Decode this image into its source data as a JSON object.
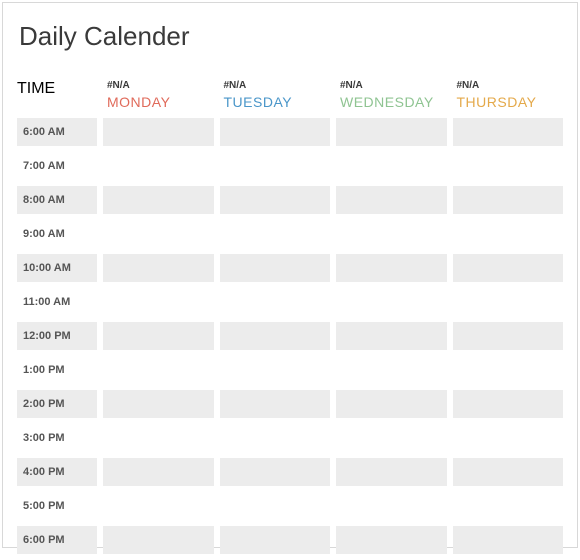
{
  "title": "Daily Calender",
  "time_label": "TIME",
  "na_label": "#N/A",
  "days": [
    {
      "name": "MONDAY",
      "color": "#e06a5a"
    },
    {
      "name": "TUESDAY",
      "color": "#4a96c9"
    },
    {
      "name": "WEDNESDAY",
      "color": "#8fc492"
    },
    {
      "name": "THURSDAY",
      "color": "#e4a94a"
    }
  ],
  "times": [
    "6:00 AM",
    "7:00 AM",
    "8:00 AM",
    "9:00 AM",
    "10:00 AM",
    "11:00 AM",
    "12:00 PM",
    "1:00 PM",
    "2:00 PM",
    "3:00 PM",
    "4:00 PM",
    "5:00 PM",
    "6:00 PM"
  ]
}
